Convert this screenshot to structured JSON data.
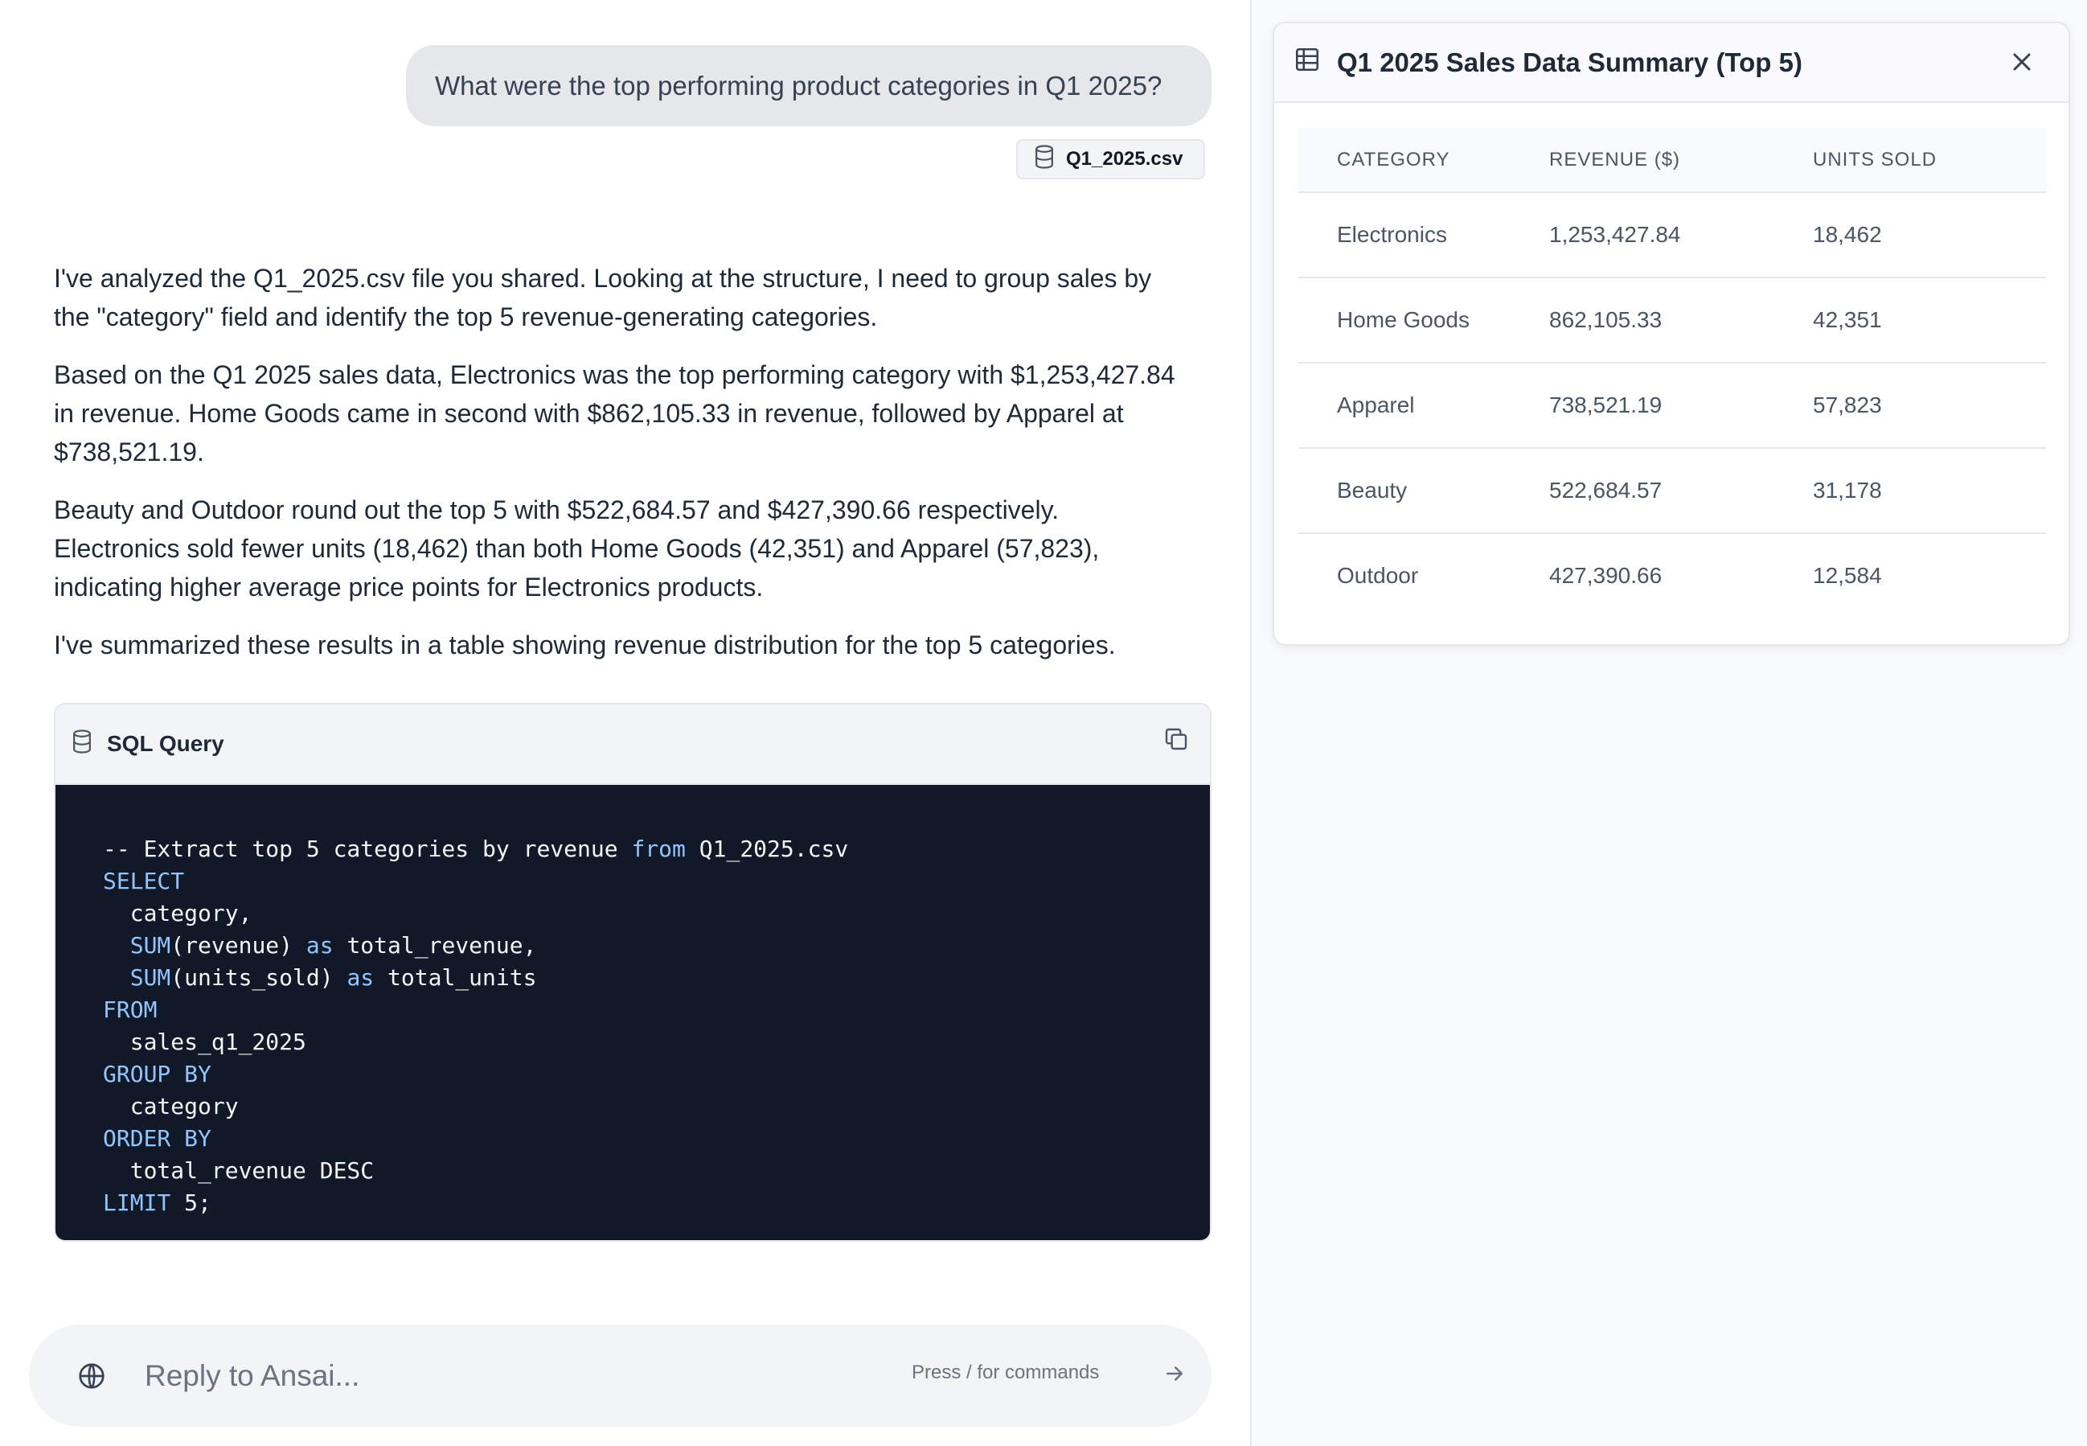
{
  "chat": {
    "user_message": "What were the top performing product categories in Q1 2025?",
    "attachment_name": "Q1_2025.csv",
    "assistant_paragraphs": [
      "I've analyzed the Q1_2025.csv file you shared. Looking at the structure, I need to group sales by the \"category\" field and identify the top 5 revenue-generating categories.",
      "Based on the Q1 2025 sales data, Electronics was the top performing category with $1,253,427.84 in revenue. Home Goods came in second with $862,105.33 in revenue, followed by Apparel at $738,521.19.",
      "Beauty and Outdoor round out the top 5 with $522,684.57 and $427,390.66 respectively. Electronics sold fewer units (18,462) than both Home Goods (42,351) and Apparel (57,823), indicating higher average price points for Electronics products.",
      "I've summarized these results in a table showing revenue distribution for the top 5 categories."
    ]
  },
  "code_block": {
    "title": "SQL Query",
    "lines": [
      "-- Extract top 5 categories by revenue from Q1_2025.csv",
      "SELECT",
      "  category,",
      "  SUM(revenue) as total_revenue,",
      "  SUM(units_sold) as total_units",
      "FROM",
      "  sales_q1_2025",
      "GROUP BY",
      "  category",
      "ORDER BY",
      "  total_revenue DESC",
      "LIMIT 5;"
    ]
  },
  "reply": {
    "placeholder": "Reply to Ansai...",
    "hint": "Press / for commands"
  },
  "summary": {
    "title": "Q1 2025 Sales Data Summary (Top 5)",
    "columns": [
      "CATEGORY",
      "REVENUE ($)",
      "UNITS SOLD"
    ],
    "rows": [
      [
        "Electronics",
        "1,253,427.84",
        "18,462"
      ],
      [
        "Home Goods",
        "862,105.33",
        "42,351"
      ],
      [
        "Apparel",
        "738,521.19",
        "57,823"
      ],
      [
        "Beauty",
        "522,684.57",
        "31,178"
      ],
      [
        "Outdoor",
        "427,390.66",
        "12,584"
      ]
    ]
  },
  "icons": {
    "attachment": "database-icon",
    "code_header": "database-icon",
    "copy": "copy-icon",
    "globe": "globe-icon",
    "send": "arrow-right-icon",
    "table": "table-icon",
    "close": "close-icon"
  },
  "colors": {
    "code_background": "#111827",
    "keyword": "#93c5fd",
    "bubble": "#e5e7eb"
  }
}
